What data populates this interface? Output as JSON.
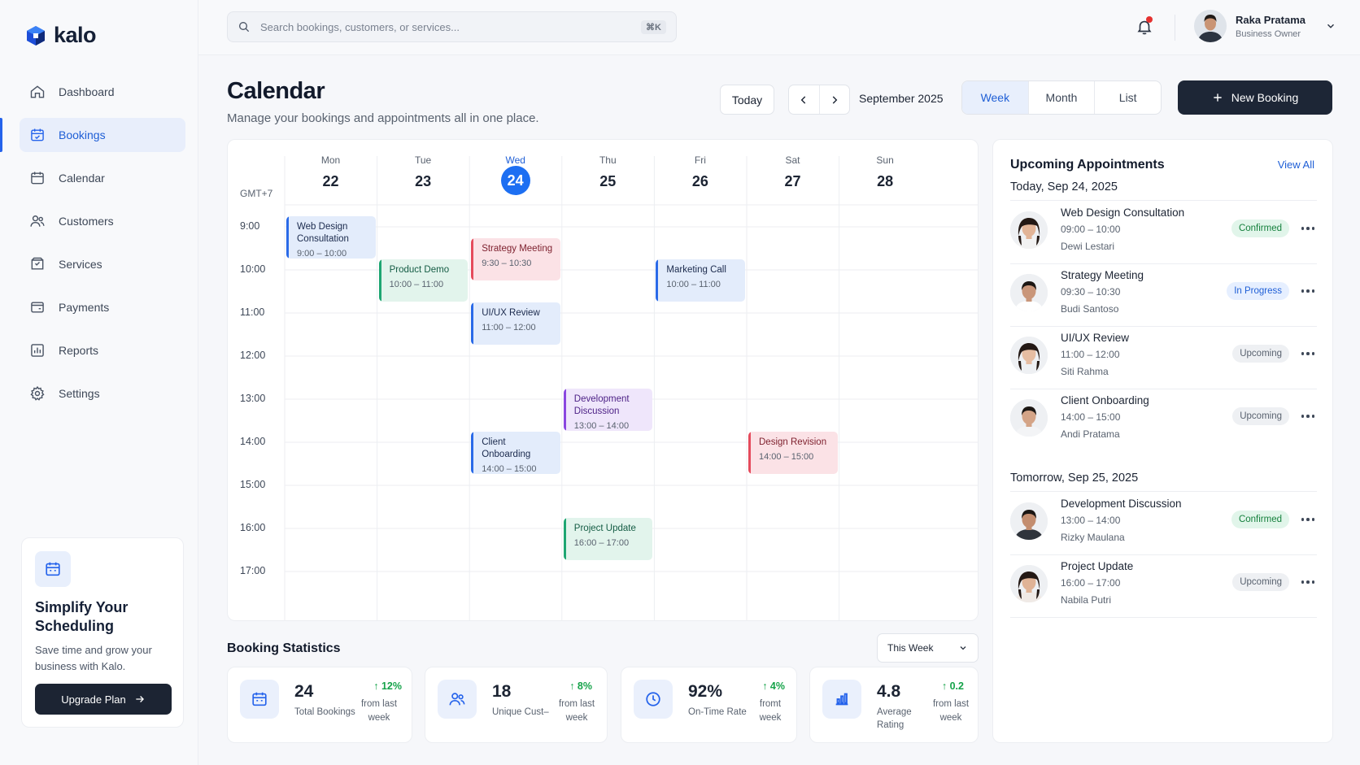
{
  "app": {
    "logo": "kalo"
  },
  "search": {
    "placeholder": "Search bookings, customers, or services...",
    "shortcut": "⌘K"
  },
  "user": {
    "name": "Raka Pratama",
    "role": "Business Owner"
  },
  "sidebar": {
    "items": [
      {
        "label": "Dashboard",
        "icon": "home-icon"
      },
      {
        "label": "Bookings",
        "icon": "calendar-check-icon",
        "active": true
      },
      {
        "label": "Calendar",
        "icon": "calendar-icon"
      },
      {
        "label": "Customers",
        "icon": "users-icon"
      },
      {
        "label": "Services",
        "icon": "box-icon"
      },
      {
        "label": "Payments",
        "icon": "wallet-icon"
      },
      {
        "label": "Reports",
        "icon": "bar-chart-icon"
      },
      {
        "label": "Settings",
        "icon": "gear-icon"
      }
    ],
    "promo": {
      "title_line1": "Simplify Your",
      "title_line2": "Scheduling",
      "text_line1": "Save time and grow your",
      "text_line2": "business with Kalo.",
      "button": "Upgrade Plan"
    }
  },
  "header": {
    "title": "Calendar",
    "subtitle": "Manage your bookings and appointments all in one place.",
    "today_button": "Today",
    "month_label": "September 2025",
    "views": [
      "Week",
      "Month",
      "List"
    ],
    "active_view": "Week",
    "new_booking": "New Booking"
  },
  "calendar": {
    "timezone": "GMT+7",
    "days": [
      {
        "name": "Mon",
        "num": "22"
      },
      {
        "name": "Tue",
        "num": "23"
      },
      {
        "name": "Wed",
        "num": "24",
        "today": true
      },
      {
        "name": "Thu",
        "num": "25"
      },
      {
        "name": "Fri",
        "num": "26"
      },
      {
        "name": "Sat",
        "num": "27"
      },
      {
        "name": "Sun",
        "num": "28"
      }
    ],
    "hours": [
      "9:00",
      "10:00",
      "11:00",
      "12:00",
      "13:00",
      "14:00",
      "15:00",
      "16:00",
      "17:00"
    ],
    "events": [
      {
        "title": "Web Design Consultation",
        "time": "9:00 – 10:00",
        "day": 0,
        "start": 9,
        "end": 10,
        "color": "blue"
      },
      {
        "title": "Product Demo",
        "time": "10:00 – 11:00",
        "day": 1,
        "start": 10,
        "end": 11,
        "color": "green"
      },
      {
        "title": "Strategy Meeting",
        "time": "9:30 – 10:30",
        "day": 2,
        "start": 9.5,
        "end": 10.5,
        "color": "red"
      },
      {
        "title": "UI/UX Review",
        "time": "11:00 – 12:00",
        "day": 2,
        "start": 11,
        "end": 12,
        "color": "blue"
      },
      {
        "title": "Client Onboarding",
        "time": "14:00 – 15:00",
        "day": 2,
        "start": 14,
        "end": 15,
        "color": "blue"
      },
      {
        "title": "Development Discussion",
        "time": "13:00 – 14:00",
        "day": 3,
        "start": 13,
        "end": 14,
        "color": "purple"
      },
      {
        "title": "Project Update",
        "time": "16:00 – 17:00",
        "day": 3,
        "start": 16,
        "end": 17,
        "color": "green"
      },
      {
        "title": "Marketing Call",
        "time": "10:00 – 11:00",
        "day": 4,
        "start": 10,
        "end": 11,
        "color": "blue"
      },
      {
        "title": "Design Revision",
        "time": "14:00 – 15:00",
        "day": 5,
        "start": 14,
        "end": 15,
        "color": "red"
      }
    ]
  },
  "stats": {
    "title": "Booking Statistics",
    "range": "This Week",
    "cards": [
      {
        "value": "24",
        "label_1": "Total Bookings",
        "label_2": "",
        "delta": "12%",
        "note_1": "from last",
        "note_2": "week",
        "icon": "calendar-icon"
      },
      {
        "value": "18",
        "label_1": "Unique Cust–",
        "label_2": "",
        "delta": "8%",
        "note_1": "from last",
        "note_2": "week",
        "icon": "users-icon"
      },
      {
        "value": "92%",
        "label_1": "On-Time Rate",
        "label_2": "",
        "delta": "4%",
        "note_1": "fromt",
        "note_2": "week",
        "icon": "clock-icon"
      },
      {
        "value": "4.8",
        "label_1": "Average",
        "label_2": "Rating",
        "delta": "0.2",
        "note_1": "from last",
        "note_2": "week",
        "icon": "bar-chart-icon"
      }
    ]
  },
  "upcoming": {
    "title": "Upcoming Appointments",
    "view_all": "View All",
    "groups": [
      {
        "date": "Today, Sep 24, 2025",
        "items": [
          {
            "title": "Web Design Consultation",
            "time": "09:00 – 10:00",
            "person": "Dewi Lestari",
            "status": "Confirmed",
            "status_type": "confirmed",
            "gender": "f"
          },
          {
            "title": "Strategy Meeting",
            "time": "09:30 – 10:30",
            "person": "Budi Santoso",
            "status": "In Progress",
            "status_type": "progress",
            "gender": "m"
          },
          {
            "title": "UI/UX Review",
            "time": "11:00 – 12:00",
            "person": "Siti Rahma",
            "status": "Upcoming",
            "status_type": "upcoming",
            "gender": "f"
          },
          {
            "title": "Client Onboarding",
            "time": "14:00 – 15:00",
            "person": "Andi Pratama",
            "status": "Upcoming",
            "status_type": "upcoming",
            "gender": "m"
          }
        ]
      },
      {
        "date": "Tomorrow, Sep 25, 2025",
        "items": [
          {
            "title": "Development Discussion",
            "time": "13:00 – 14:00",
            "person": "Rizky Maulana",
            "status": "Confirmed",
            "status_type": "confirmed",
            "gender": "m"
          },
          {
            "title": "Project Update",
            "time": "16:00 – 17:00",
            "person": "Nabila Putri",
            "status": "Upcoming",
            "status_type": "upcoming",
            "gender": "f"
          }
        ]
      }
    ]
  }
}
